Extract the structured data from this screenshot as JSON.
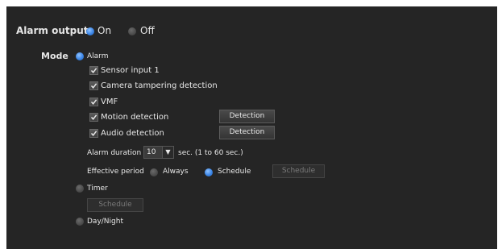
{
  "alarm_output": {
    "label": "Alarm output",
    "on_label": "On",
    "off_label": "Off",
    "selected": "On"
  },
  "mode": {
    "label": "Mode",
    "options": {
      "alarm": "Alarm",
      "timer": "Timer",
      "day_night": "Day/Night"
    },
    "selected": "Alarm"
  },
  "alarm": {
    "checkboxes": [
      {
        "label": "Sensor input 1",
        "checked": true
      },
      {
        "label": "Camera tampering detection",
        "checked": true
      },
      {
        "label": "VMF",
        "checked": true
      },
      {
        "label": "Motion detection",
        "checked": true
      },
      {
        "label": "Audio detection",
        "checked": true
      }
    ],
    "motion_detection_button": "Detection",
    "audio_detection_button": "Detection",
    "duration": {
      "label": "Alarm duration",
      "value": "10",
      "unit": "sec. (1 to 60 sec.)"
    },
    "effective_period": {
      "label": "Effective period",
      "always_label": "Always",
      "schedule_label": "Schedule",
      "selected": "Schedule",
      "schedule_button": "Schedule"
    }
  },
  "timer": {
    "schedule_button": "Schedule"
  },
  "colors": {
    "panel_bg": "#252525",
    "radio_selected": "#3c86e6",
    "text": "#e8e8e8"
  }
}
